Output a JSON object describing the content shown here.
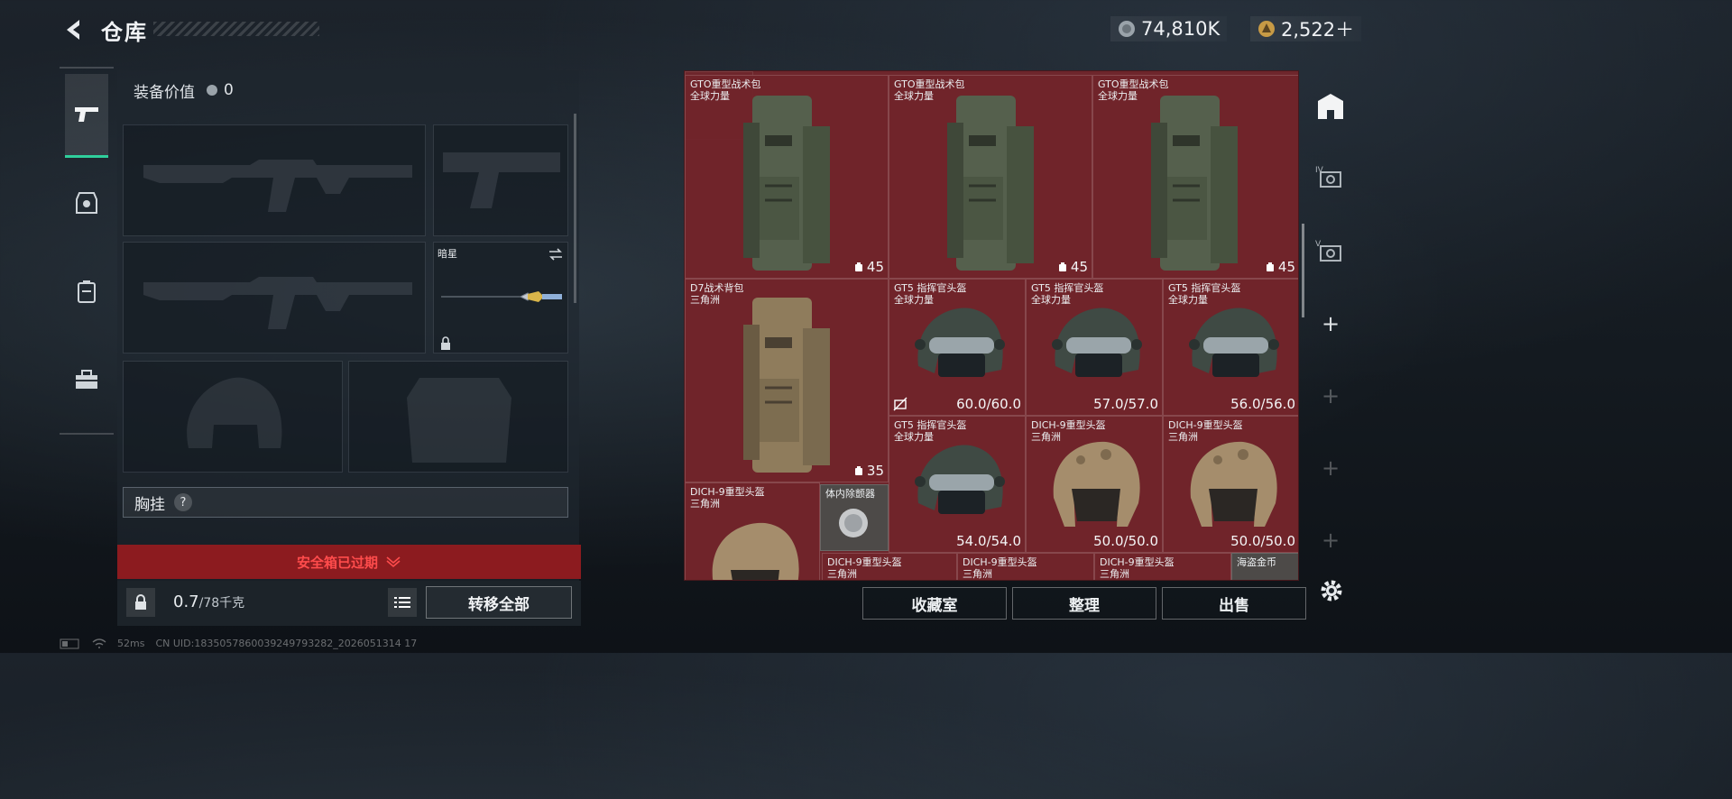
{
  "header": {
    "title": "仓库",
    "currency_coins": "74,810K",
    "currency_tokens": "2,522＋"
  },
  "sidebar": {
    "tabs": [
      {
        "name": "weapons",
        "icon": "pistol-icon",
        "active": true
      },
      {
        "name": "armor",
        "icon": "armor-icon",
        "active": false
      },
      {
        "name": "backpack",
        "icon": "backpack-icon",
        "active": false
      },
      {
        "name": "case",
        "icon": "briefcase-icon",
        "active": false
      }
    ]
  },
  "loadout": {
    "equip_value_label": "装备价值",
    "equip_value": "0",
    "melee_name": "暗星",
    "chest_rig_label": "胸挂",
    "chest_rig_help": "?",
    "safebox_warning": "安全箱已过期",
    "weight_value": "0.7",
    "weight_max": "/78千克",
    "transfer_all": "转移全部"
  },
  "grid": {
    "items": [
      {
        "name": "GTO重型战术包",
        "region": "全球力量",
        "capacity": "45",
        "type": "backpack"
      },
      {
        "name": "GTO重型战术包",
        "region": "全球力量",
        "capacity": "45",
        "type": "backpack"
      },
      {
        "name": "GTO重型战术包",
        "region": "全球力量",
        "capacity": "45",
        "type": "backpack"
      },
      {
        "name": "D7战术背包",
        "region": "三角洲",
        "capacity": "35",
        "type": "backpack"
      },
      {
        "name": "GT5 指挥官头盔",
        "region": "全球力量",
        "durability": "60.0/60.0",
        "type": "helmet"
      },
      {
        "name": "GT5 指挥官头盔",
        "region": "全球力量",
        "durability": "57.0/57.0",
        "type": "helmet"
      },
      {
        "name": "GT5 指挥官头盔",
        "region": "全球力量",
        "durability": "56.0/56.0",
        "type": "helmet"
      },
      {
        "name": "GT5 指挥官头盔",
        "region": "全球力量",
        "durability": "54.0/54.0",
        "type": "helmet"
      },
      {
        "name": "DICH-9重型头盔",
        "region": "三角洲",
        "durability": "50.0/50.0",
        "type": "helmet"
      },
      {
        "name": "DICH-9重型头盔",
        "region": "三角洲",
        "durability": "50.0/50.0",
        "type": "helmet"
      },
      {
        "name": "DICH-9重型头盔",
        "region": "三角洲",
        "type": "helmet"
      },
      {
        "name": "体内除颤器",
        "type": "device"
      },
      {
        "name": "DICH-9重型头盔",
        "region": "三角洲",
        "type": "helmet"
      },
      {
        "name": "DICH-9重型头盔",
        "region": "三角洲",
        "type": "helmet"
      },
      {
        "name": "DICH-9重型头盔",
        "region": "三角洲",
        "type": "helmet"
      },
      {
        "name": "海盗金币",
        "type": "coin"
      }
    ]
  },
  "actions": {
    "collection_room": "收藏室",
    "organize": "整理",
    "sell": "出售"
  },
  "right_rail": {
    "tier4_label": "IV",
    "tier5_label": "V"
  },
  "status": {
    "ping": "52ms",
    "uid": "CN UID:1835057860039249793282_2026051314 17"
  }
}
